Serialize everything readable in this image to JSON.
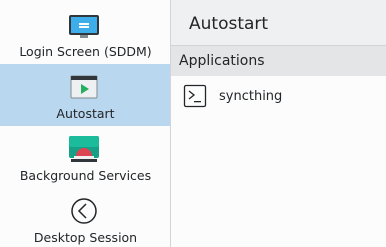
{
  "sidebar": {
    "items": [
      {
        "label": "Login Screen (SDDM)",
        "icon": "monitor-icon"
      },
      {
        "label": "Autostart",
        "icon": "autostart-icon",
        "selected": true
      },
      {
        "label": "Background Services",
        "icon": "services-icon"
      },
      {
        "label": "Desktop Session",
        "icon": "back-arrow-icon"
      }
    ]
  },
  "main": {
    "title": "Autostart",
    "section_header": "Applications",
    "applications": [
      {
        "name": "syncthing",
        "icon": "terminal-icon"
      }
    ]
  },
  "colors": {
    "selection": "#b9d7ef",
    "sidebar_bg": "#fcfcfc",
    "window_bg": "#eff0f1",
    "header_bg": "#e3e5e7"
  }
}
